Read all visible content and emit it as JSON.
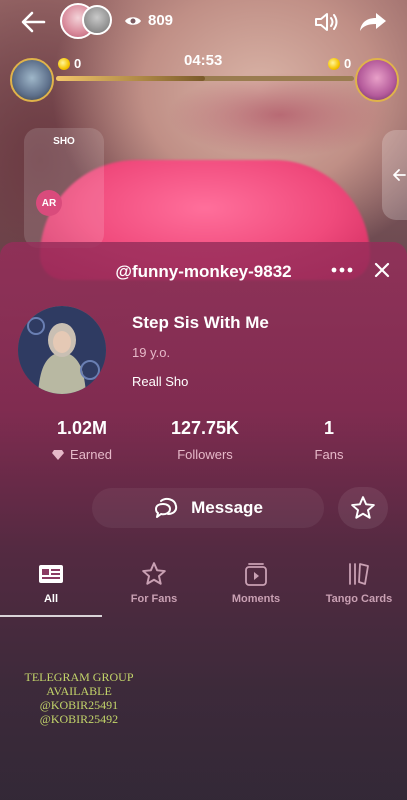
{
  "header": {
    "viewer_count": "809",
    "timer": "04:53"
  },
  "battle": {
    "left_score": "0",
    "right_score": "0",
    "progress_fraction": 0.5
  },
  "mini_panel": {
    "title": "SHO",
    "badge": "AR"
  },
  "profile": {
    "username": "@funny-monkey-9832",
    "display_name": "Step Sis With Me",
    "age": "19 y.o.",
    "bio": "Reall Sho"
  },
  "stats": [
    {
      "value": "1.02M",
      "label": "Earned",
      "icon": "diamond-icon"
    },
    {
      "value": "127.75K",
      "label": "Followers"
    },
    {
      "value": "1",
      "label": "Fans"
    }
  ],
  "actions": {
    "message_label": "Message"
  },
  "tabs": [
    {
      "label": "All",
      "icon": "profile-card-icon",
      "active": true
    },
    {
      "label": "For Fans",
      "icon": "star-icon"
    },
    {
      "label": "Moments",
      "icon": "moments-play-icon"
    },
    {
      "label": "Tango Cards",
      "icon": "cards-icon"
    }
  ],
  "overlay_text": {
    "line1": "TELEGRAM GROUP",
    "line2": "AVAILABLE",
    "line3": "@KOBIR25491",
    "line4": "@KOBIR25492"
  },
  "colors": {
    "accent_gold": "#e0b34a",
    "coin": "#f5c400",
    "sheet_pink": "#962d5a",
    "overlay_text": "#c3d56a"
  }
}
